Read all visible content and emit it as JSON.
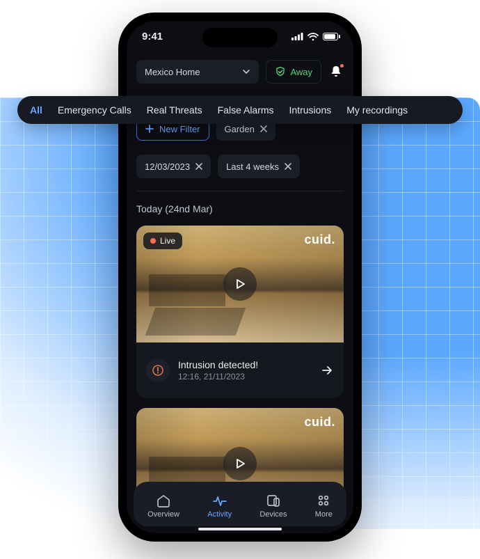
{
  "status": {
    "time": "9:41"
  },
  "header": {
    "location": "Mexico Home",
    "mode_label": "Away"
  },
  "tabs": [
    {
      "label": "All",
      "active": true
    },
    {
      "label": "Emergency Calls"
    },
    {
      "label": "Real Threats"
    },
    {
      "label": "False Alarms"
    },
    {
      "label": "Intrusions"
    },
    {
      "label": "My recordings"
    }
  ],
  "filters": {
    "new_filter_label": "New Filter",
    "chips": [
      {
        "label": "Garden"
      },
      {
        "label": "12/03/2023"
      },
      {
        "label": "Last 4 weeks"
      }
    ]
  },
  "section": {
    "title": "Today (24nd Mar)"
  },
  "cards": [
    {
      "live_label": "Live",
      "brand": "cuid.",
      "alert_title": "Intrusion detected!",
      "alert_time": "12:16, 21/11/2023"
    },
    {
      "brand": "cuid."
    }
  ],
  "nav": [
    {
      "label": "Overview"
    },
    {
      "label": "Activity",
      "active": true
    },
    {
      "label": "Devices"
    },
    {
      "label": "More"
    }
  ]
}
